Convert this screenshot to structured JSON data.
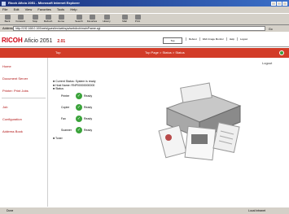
{
  "window": {
    "title": "Ricoh Aficio 2051 - Microsoft Internet Explorer"
  },
  "menu": [
    "File",
    "Edit",
    "View",
    "Favorites",
    "Tools",
    "Help"
  ],
  "toolbar": [
    "Back",
    "Forward",
    "Stop",
    "Refresh",
    "Home",
    "Search",
    "Favorites",
    "History",
    "Mail",
    "Print"
  ],
  "address": {
    "label": "Address",
    "value": "http://192.168.0.100/web/guest/en/websys/webArch/mainFrame.cgi",
    "go": "Go"
  },
  "header": {
    "brand": "RICOH",
    "model": "Aficio 2051",
    "version": "2.01",
    "select_label": "Top",
    "links": [
      "Reboot",
      "Web Image Monitor",
      "Help",
      "Logout"
    ]
  },
  "sidebar": {
    "items": [
      "Home",
      "Document Server",
      "Printer: Print Jobs",
      "Job",
      "Configuration",
      "Address Book"
    ]
  },
  "section": {
    "label": "Top",
    "title": "Top Page > Status > Status"
  },
  "logout_label": "Logout",
  "info_lines": [
    "Current Status: System is ready",
    "Host Name: RNP00000000000",
    "Status"
  ],
  "trays": [
    {
      "name": "Printer",
      "status": "Ready"
    },
    {
      "name": "Copier",
      "status": "Ready"
    },
    {
      "name": "Fax",
      "status": "Ready"
    },
    {
      "name": "Scanner",
      "status": "Ready"
    }
  ],
  "trays_footer": "Toner",
  "statusbar": {
    "left": "Done",
    "right": "Local intranet"
  }
}
